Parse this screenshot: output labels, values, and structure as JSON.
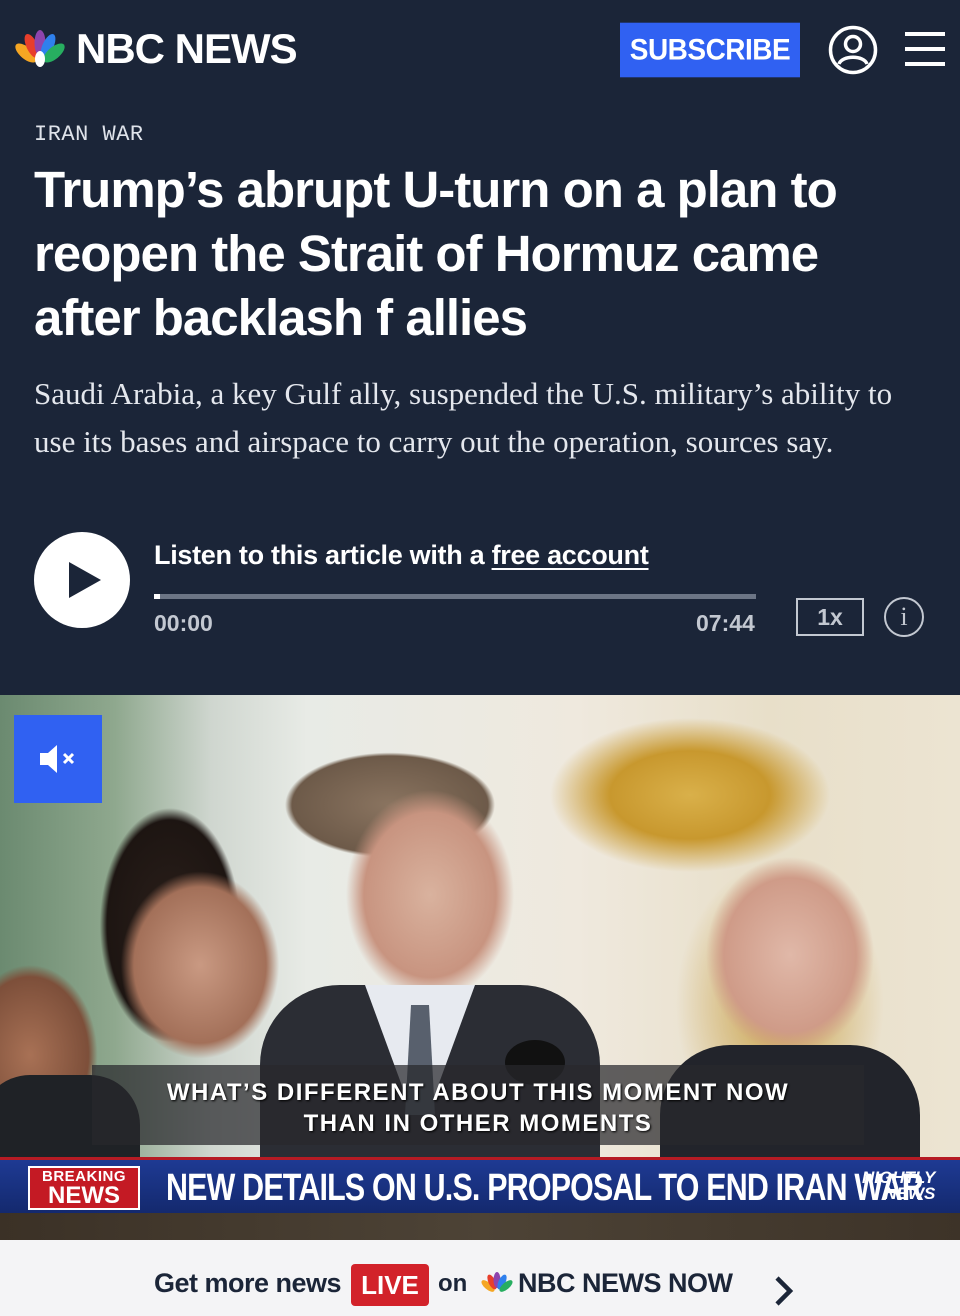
{
  "header": {
    "brand": "NBC NEWS",
    "subscribe_label": "SUBSCRIBE",
    "account_icon": "user-circle-icon",
    "menu_icon": "hamburger-menu-icon",
    "brand_color": "#1b2538",
    "accent_color": "#3061f2"
  },
  "article": {
    "eyebrow": "IRAN WAR",
    "headline": "Trump’s abrupt U-turn on a plan to reopen the Strait of Hormuz came after backlash f      allies",
    "dek": "Saudi Arabia, a key Gulf ally, suspended the U.S. military’s ability to use its bases and airspace to carry out the operation, sources say."
  },
  "audio": {
    "listen_prefix": "Listen to this article with a ",
    "listen_link": "free account",
    "time_current": "00:00",
    "time_total": "07:44",
    "speed": "1x",
    "info_glyph": "i",
    "progress_fraction": 0.01
  },
  "video": {
    "caption_line1": "WHAT’S DIFFERENT ABOUT THIS MOMENT NOW",
    "caption_line2": "THAN IN OTHER MOMENTS",
    "breaking_small": "BREAKING",
    "breaking_big": "NEWS",
    "ticker": "NEW DETAILS ON U.S. PROPOSAL TO END IRAN WAR",
    "nightly_line1": "NIGHTLY",
    "nightly_line2": "NEWS",
    "mute_icon": "speaker-muted-icon"
  },
  "banner": {
    "prefix": "Get more news",
    "live": "LIVE",
    "on": "on",
    "product": "NBC NEWS NOW",
    "chevron_icon": "chevron-right-icon"
  }
}
